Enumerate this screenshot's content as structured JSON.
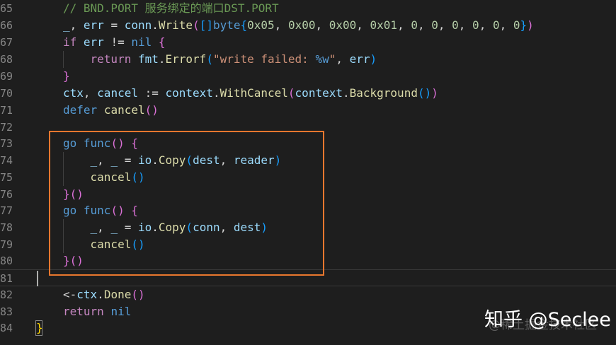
{
  "editor": {
    "line_numbers": [
      "65",
      "66",
      "67",
      "68",
      "69",
      "70",
      "71",
      "72",
      "73",
      "74",
      "75",
      "76",
      "77",
      "78",
      "79",
      "80",
      "81",
      "82",
      "83",
      "84"
    ],
    "comment_text": "// BND.PORT 服务绑定的端口DST.PORT",
    "current_line": "81"
  },
  "colors": {
    "background": "#1e1e1e",
    "highlight_box": "#e8772e",
    "keyword": "#569cd6",
    "control_keyword": "#c586c0",
    "function": "#dcdcaa",
    "string": "#ce9178",
    "number": "#b5cea8",
    "type": "#4ec9b0"
  },
  "watermark": {
    "text": "知乎 @Seclee",
    "faint_text": "@稀土掘金技术社区"
  }
}
